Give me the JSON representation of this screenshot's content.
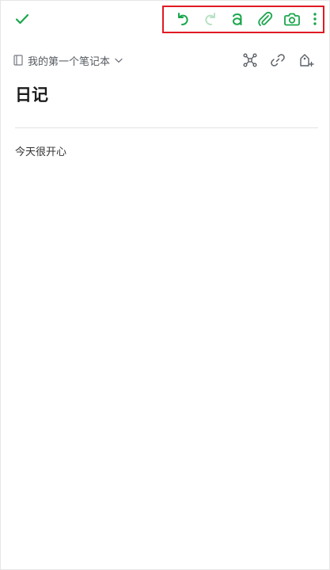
{
  "toolbar": {
    "done_icon": "checkmark-icon",
    "actions": [
      "undo-icon",
      "redo-icon",
      "text-format-icon",
      "attachment-icon",
      "camera-icon",
      "more-vertical-icon"
    ],
    "accent_color": "#1aa64b",
    "disabled_color": "#b8e2c6",
    "highlight_color": "#e01a22"
  },
  "notebook": {
    "name": "我的第一个笔记本",
    "actions": [
      "network-icon",
      "link-icon",
      "add-tag-icon"
    ]
  },
  "note": {
    "title": "日记",
    "body": "今天很开心"
  }
}
